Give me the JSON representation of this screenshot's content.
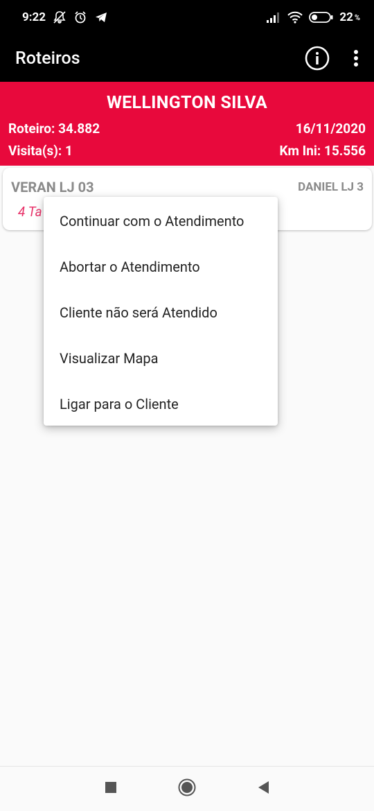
{
  "status_bar": {
    "time": "9:22",
    "battery": "22",
    "battery_unit": "%"
  },
  "app_bar": {
    "title": "Roteiros"
  },
  "header": {
    "name": "WELLINGTON SILVA",
    "roteiro": "Roteiro: 34.882",
    "date": "16/11/2020",
    "visitas": "Visita(s): 1",
    "km_ini": "Km Ini: 15.556"
  },
  "card": {
    "title": "VERAN LJ 03",
    "right_label": "DANIEL LJ 3",
    "subtitle": "4 Ta"
  },
  "menu": {
    "items": [
      "Continuar com o Atendimento",
      "Abortar o Atendimento",
      "Cliente não será Atendido",
      "Visualizar Mapa",
      "Ligar para o Cliente"
    ]
  },
  "colors": {
    "accent": "#e8093c",
    "subtitle": "#e8336a",
    "bar": "#000000"
  }
}
